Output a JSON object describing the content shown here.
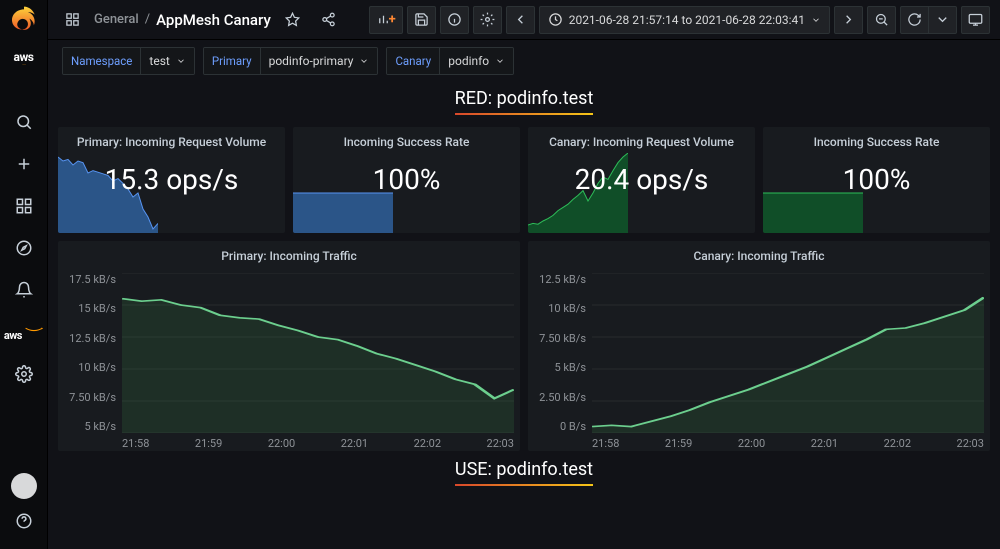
{
  "breadcrumb": {
    "folder": "General",
    "title": "AppMesh Canary"
  },
  "time_range": "2021-06-28 21:57:14 to 2021-06-28 22:03:41",
  "variables": [
    {
      "label": "Namespace",
      "value": "test"
    },
    {
      "label": "Primary",
      "value": "podinfo-primary"
    },
    {
      "label": "Canary",
      "value": "podinfo"
    }
  ],
  "rows": {
    "red": {
      "title": "RED: podinfo.test"
    },
    "use": {
      "title": "USE: podinfo.test"
    }
  },
  "stat_panels": [
    {
      "title": "Primary: Incoming Request Volume",
      "value": "15.3 ops/s",
      "color": "blue"
    },
    {
      "title": "Incoming Success Rate",
      "value": "100%",
      "color": "blue"
    },
    {
      "title": "Canary: Incoming Request Volume",
      "value": "20.4 ops/s",
      "color": "green"
    },
    {
      "title": "Incoming Success Rate",
      "value": "100%",
      "color": "green"
    }
  ],
  "traffic_panels": {
    "primary": {
      "title": "Primary: Incoming Traffic"
    },
    "canary": {
      "title": "Canary: Incoming Traffic"
    }
  },
  "chart_data": [
    {
      "id": "primary_traffic",
      "type": "area",
      "title": "Primary: Incoming Traffic",
      "x": [
        "21:58",
        "21:59",
        "22:00",
        "22:01",
        "22:02",
        "22:03"
      ],
      "y_ticks": [
        "17.5 kB/s",
        "15 kB/s",
        "12.5 kB/s",
        "10 kB/s",
        "7.50 kB/s",
        "5 kB/s"
      ],
      "ylim_kBps": [
        5,
        17.5
      ],
      "series": [
        {
          "name": "Primary",
          "values_kBps": [
            15.5,
            15.3,
            15.4,
            15.0,
            14.8,
            14.2,
            14.0,
            13.9,
            13.4,
            13.0,
            12.5,
            12.3,
            11.8,
            11.2,
            10.8,
            10.3,
            9.8,
            9.2,
            8.8,
            7.7,
            8.4
          ]
        }
      ]
    },
    {
      "id": "canary_traffic",
      "type": "area",
      "title": "Canary: Incoming Traffic",
      "x": [
        "21:58",
        "21:59",
        "22:00",
        "22:01",
        "22:02",
        "22:03"
      ],
      "y_ticks": [
        "12.5 kB/s",
        "10 kB/s",
        "7.50 kB/s",
        "5 kB/s",
        "2.50 kB/s",
        "0 B/s"
      ],
      "ylim_kBps": [
        0,
        12.5
      ],
      "series": [
        {
          "name": "Canary",
          "values_kBps": [
            0.5,
            0.6,
            0.5,
            0.9,
            1.3,
            1.8,
            2.4,
            2.9,
            3.4,
            4.0,
            4.6,
            5.2,
            5.9,
            6.6,
            7.3,
            8.1,
            8.2,
            8.6,
            9.1,
            9.6,
            10.6
          ]
        }
      ]
    },
    {
      "id": "primary_req_spark",
      "type": "area",
      "values_norm": [
        0.95,
        0.9,
        0.92,
        0.85,
        0.9,
        0.88,
        0.75,
        0.78,
        0.76,
        0.74,
        0.72,
        0.65,
        0.68,
        0.62,
        0.55,
        0.45,
        0.5,
        0.3,
        0.2,
        0.05,
        0.12
      ]
    },
    {
      "id": "primary_success_spark",
      "type": "area",
      "values_norm": [
        0.5,
        0.5,
        0.5,
        0.5,
        0.5,
        0.5,
        0.5,
        0.5,
        0.5,
        0.5,
        0.5,
        0.5,
        0.5,
        0.5,
        0.5,
        0.5,
        0.5,
        0.5,
        0.5,
        0.5,
        0.5
      ]
    },
    {
      "id": "canary_req_spark",
      "type": "area",
      "values_norm": [
        0.1,
        0.12,
        0.11,
        0.15,
        0.18,
        0.22,
        0.28,
        0.32,
        0.36,
        0.42,
        0.47,
        0.53,
        0.4,
        0.5,
        0.62,
        0.7,
        0.67,
        0.78,
        0.88,
        0.95,
        1.0
      ]
    },
    {
      "id": "canary_success_spark",
      "type": "area",
      "values_norm": [
        0.5,
        0.5,
        0.5,
        0.5,
        0.5,
        0.5,
        0.5,
        0.5,
        0.5,
        0.5,
        0.5,
        0.5,
        0.5,
        0.5,
        0.5,
        0.5,
        0.5,
        0.5,
        0.5,
        0.5,
        0.5
      ]
    }
  ],
  "sidebar": {
    "brand": "aws",
    "items": [
      "search",
      "create",
      "dashboards",
      "explore",
      "alerting",
      "aws",
      "configuration"
    ]
  }
}
